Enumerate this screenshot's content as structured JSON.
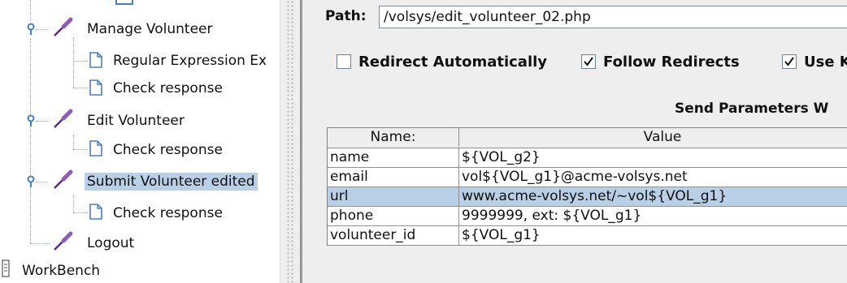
{
  "tree": {
    "nodes": [
      {
        "label": "Manage Volunteer"
      },
      {
        "label": "Regular Expression Ex"
      },
      {
        "label": "Check response"
      },
      {
        "label": "Edit Volunteer"
      },
      {
        "label": "Check response"
      },
      {
        "label": "Submit Volunteer edited"
      },
      {
        "label": "Check response"
      },
      {
        "label": "Logout"
      },
      {
        "label": "WorkBench"
      }
    ]
  },
  "request": {
    "path_label": "Path:",
    "path_value": "/volsys/edit_volunteer_02.php",
    "checkboxes": [
      {
        "label": "Redirect Automatically",
        "checked": false
      },
      {
        "label": "Follow Redirects",
        "checked": true
      },
      {
        "label": "Use K",
        "checked": true
      }
    ],
    "send_title": "Send Parameters W"
  },
  "params_table": {
    "headers": [
      "Name:",
      "Value"
    ],
    "rows": [
      {
        "name": "name",
        "value": "${VOL_g2}"
      },
      {
        "name": "email",
        "value": "vol${VOL_g1}@acme-volsys.net"
      },
      {
        "name": "url",
        "value": "www.acme-volsys.net/~vol${VOL_g1}"
      },
      {
        "name": "phone",
        "value": "9999999, ext: ${VOL_g1}"
      },
      {
        "name": "volunteer_id",
        "value": "${VOL_g1}"
      }
    ],
    "selected_row": 2
  },
  "colors": {
    "selection": "#b8cfe5",
    "panel_bg": "#eeeeee",
    "checkbox_border": "#6f8396"
  }
}
